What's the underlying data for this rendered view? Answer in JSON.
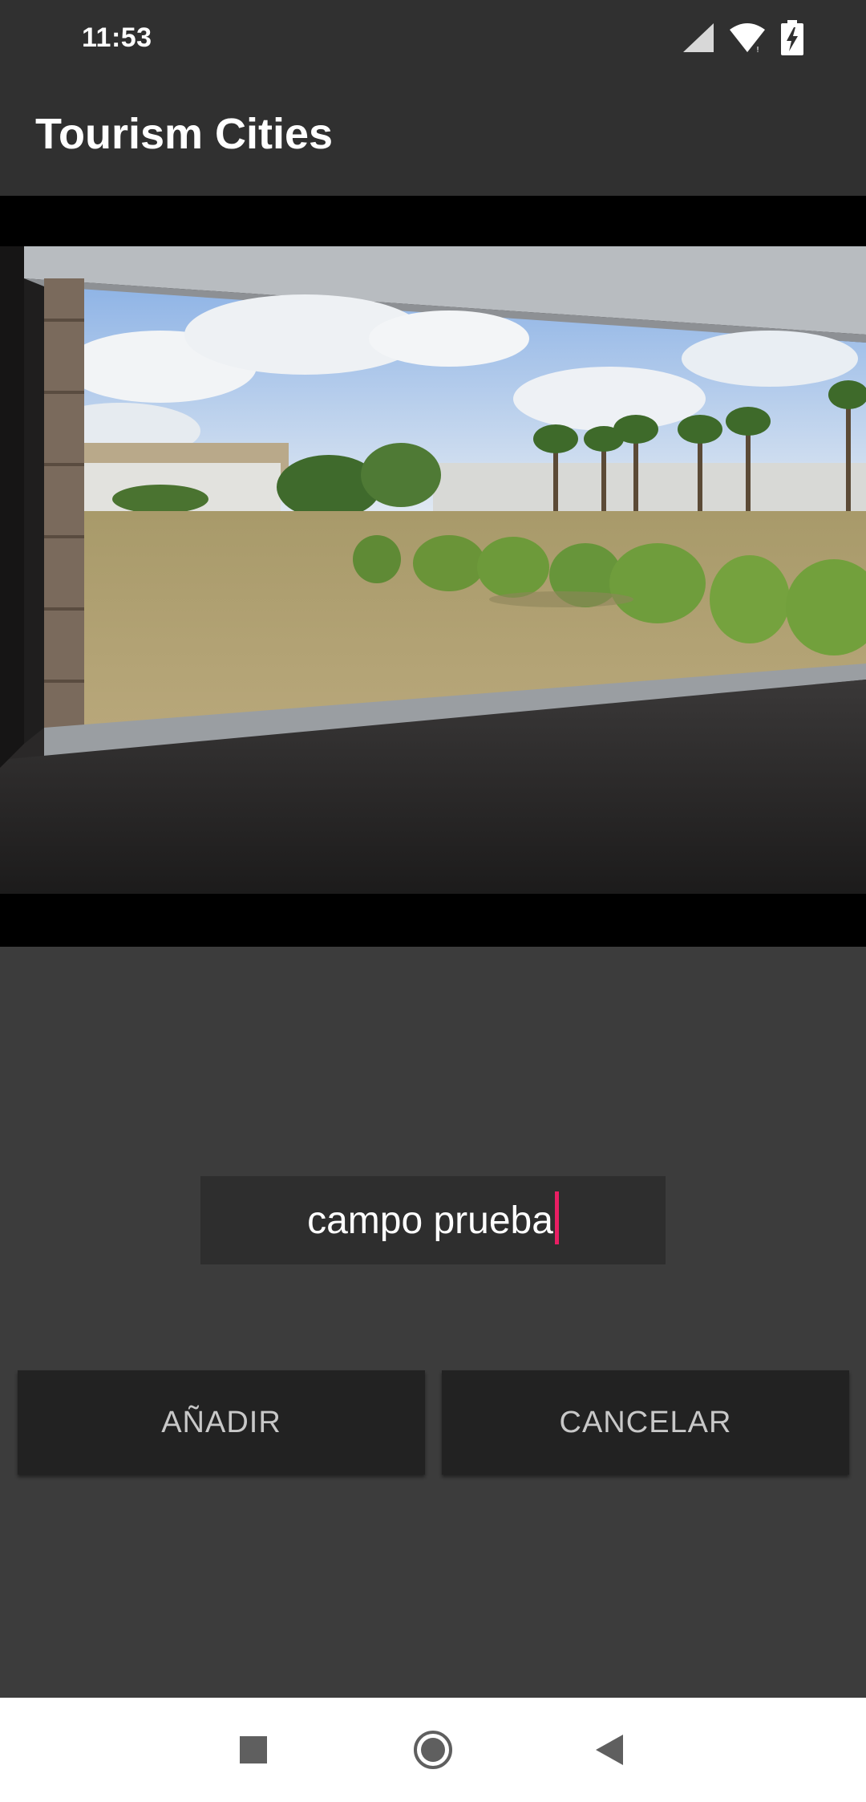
{
  "status_bar": {
    "time": "11:53",
    "icons": [
      "cellular-signal-icon",
      "wifi-icon",
      "battery-charging-icon"
    ]
  },
  "app_bar": {
    "title": "Tourism Cities"
  },
  "photo": {
    "description_icon": "captured-photo-image"
  },
  "form": {
    "name_value": "campo prueba",
    "caret_color": "#e91e63"
  },
  "buttons": {
    "add_label": "AÑADIR",
    "cancel_label": "CANCELAR"
  },
  "nav_bar": {
    "icons": [
      "recents-square-icon",
      "home-circle-icon",
      "back-triangle-icon"
    ]
  },
  "colors": {
    "header": "#303030",
    "background": "#3c3c3c",
    "button": "#222222",
    "accent": "#e91e63"
  }
}
